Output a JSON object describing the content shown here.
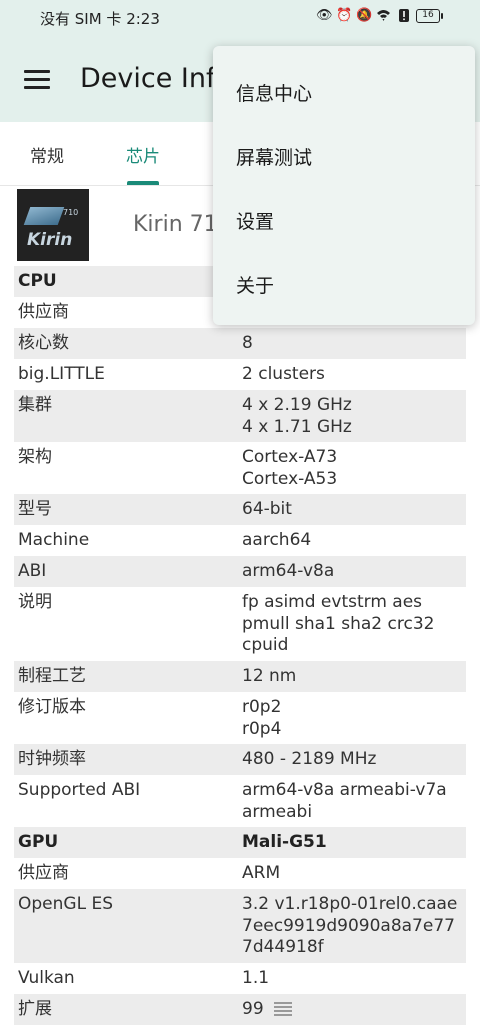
{
  "status": {
    "left_text": "没有 SIM 卡 2:23",
    "icons": [
      "eye-icon",
      "alarm-icon",
      "mute-icon",
      "wifi-icon",
      "alert-icon",
      "battery-icon"
    ],
    "battery_level": "16"
  },
  "appbar": {
    "title": "Device Info"
  },
  "tabs": [
    {
      "label": "常规",
      "active": false
    },
    {
      "label": "芯片",
      "active": true
    }
  ],
  "chip": {
    "logo_model": "710",
    "logo_word": "Kirin",
    "name": "Kirin 710"
  },
  "menu": {
    "items": [
      "信息中心",
      "屏幕测试",
      "设置",
      "关于"
    ]
  },
  "rows": [
    {
      "k": "CPU",
      "v": "",
      "head": true
    },
    {
      "k": "供应商",
      "v": ""
    },
    {
      "k": "核心数",
      "v": "8"
    },
    {
      "k": "big.LITTLE",
      "v": "2 clusters"
    },
    {
      "k": "集群",
      "v": "4 x 2.19 GHz\n4 x 1.71 GHz"
    },
    {
      "k": "架构",
      "v": "Cortex-A73\nCortex-A53"
    },
    {
      "k": "型号",
      "v": "64-bit"
    },
    {
      "k": "Machine",
      "v": "aarch64"
    },
    {
      "k": "ABI",
      "v": "arm64-v8a"
    },
    {
      "k": "说明",
      "v": "fp asimd evtstrm aes\npmull sha1 sha2 crc32\ncpuid"
    },
    {
      "k": "制程工艺",
      "v": "12 nm"
    },
    {
      "k": "修订版本",
      "v": "r0p2\nr0p4"
    },
    {
      "k": "时钟频率",
      "v": "480 - 2189 MHz"
    },
    {
      "k": "Supported ABI",
      "v": "arm64-v8a armeabi-v7a\narmeabi"
    },
    {
      "k": "GPU",
      "v": "Mali-G51",
      "head": true
    },
    {
      "k": "供应商",
      "v": "ARM"
    },
    {
      "k": "OpenGL ES",
      "v": "3.2 v1.r18p0-01rel0.caae\n7eec9919d9090a8a7e77\n7d44918f"
    },
    {
      "k": "Vulkan",
      "v": "1.1"
    },
    {
      "k": "扩展",
      "v": "99"
    }
  ]
}
